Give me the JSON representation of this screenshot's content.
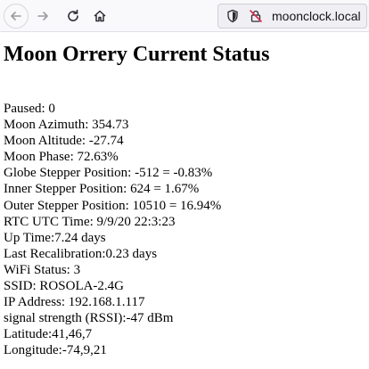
{
  "browser": {
    "url": "moonclock.local"
  },
  "page": {
    "title": "Moon Orrery Current Status",
    "rows": [
      "Paused: 0",
      "Moon Azimuth: 354.73",
      "Moon Altitude: -27.74",
      "Moon Phase: 72.63%",
      "Globe Stepper Position: -512 = -0.83%",
      "Inner Stepper Position: 624 = 1.67%",
      "Outer Stepper Position: 10510 = 16.94%",
      "RTC UTC Time: 9/9/20 22:3:23",
      "Up Time:7.24 days",
      "Last Recalibration:0.23 days",
      "WiFi Status: 3",
      "SSID: ROSOLA-2.4G",
      "IP Address: 192.168.1.117",
      "signal strength (RSSI):-47 dBm",
      "Latitude:41,46,7",
      "Longitude:-74,9,21"
    ]
  }
}
